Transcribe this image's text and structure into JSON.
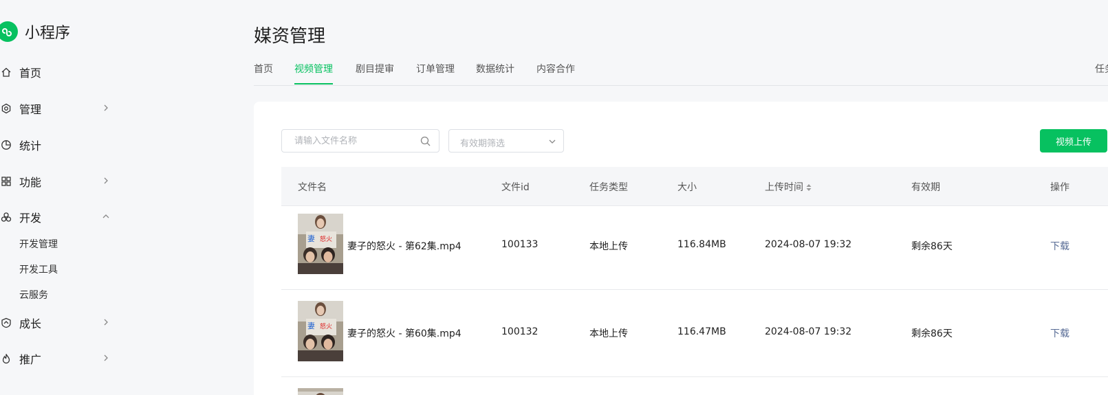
{
  "app": {
    "title": "小程序"
  },
  "sidebar": {
    "items": [
      {
        "label": "首页"
      },
      {
        "label": "管理"
      },
      {
        "label": "统计"
      },
      {
        "label": "功能"
      },
      {
        "label": "开发"
      },
      {
        "label": "成长"
      },
      {
        "label": "推广"
      }
    ],
    "dev_subitems": [
      {
        "label": "开发管理"
      },
      {
        "label": "开发工具"
      },
      {
        "label": "云服务"
      }
    ]
  },
  "header": {
    "title": "媒资管理",
    "tabs": [
      {
        "label": "首页"
      },
      {
        "label": "视频管理"
      },
      {
        "label": "剧目提审"
      },
      {
        "label": "订单管理"
      },
      {
        "label": "数据统计"
      },
      {
        "label": "内容合作"
      }
    ],
    "active_tab": "视频管理",
    "right_link": "任务"
  },
  "toolbar": {
    "search_placeholder": "请输入文件名称",
    "filter_placeholder": "有效期筛选",
    "upload_label": "视频上传"
  },
  "table": {
    "columns": [
      "文件名",
      "文件id",
      "任务类型",
      "大小",
      "上传时间",
      "有效期",
      "操作"
    ],
    "rows": [
      {
        "filename": "妻子的怒火 - 第62集.mp4",
        "id": "100133",
        "type": "本地上传",
        "size": "116.84MB",
        "time": "2024-08-07 19:32",
        "validity": "剩余86天",
        "action": "下载"
      },
      {
        "filename": "妻子的怒火 - 第60集.mp4",
        "id": "100132",
        "type": "本地上传",
        "size": "116.47MB",
        "time": "2024-08-07 19:32",
        "validity": "剩余86天",
        "action": "下载"
      }
    ]
  },
  "colors": {
    "accent": "#07c160",
    "link": "#576b95"
  }
}
